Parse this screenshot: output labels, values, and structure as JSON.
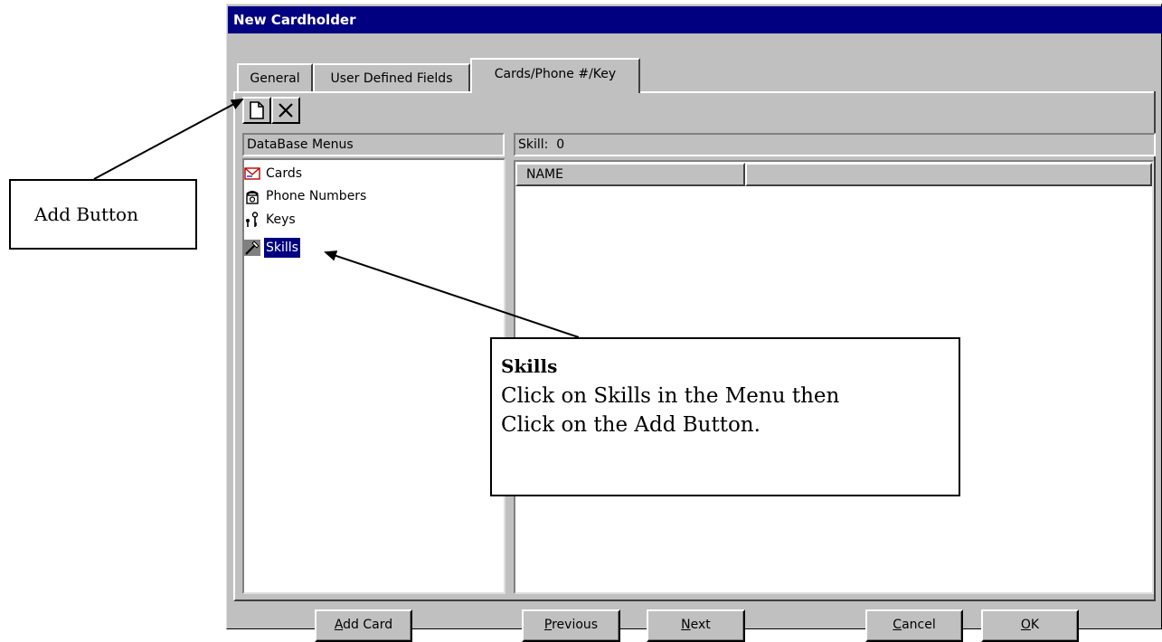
{
  "window": {
    "title": "New Cardholder"
  },
  "tabs": [
    {
      "label": "General",
      "active": false
    },
    {
      "label": "User Defined Fields",
      "active": false
    },
    {
      "label": "Cards/Phone #/Key",
      "active": true
    }
  ],
  "toolbar": {
    "add_icon": "new-document-icon",
    "delete_icon": "delete-x-icon"
  },
  "left_panel": {
    "header": "DataBase Menus",
    "items": [
      {
        "label": "Cards",
        "icon": "cards-icon",
        "selected": false
      },
      {
        "label": "Phone Numbers",
        "icon": "phone-icon",
        "selected": false
      },
      {
        "label": "Keys",
        "icon": "keys-icon",
        "selected": false
      },
      {
        "label": "Skills",
        "icon": "skills-icon",
        "selected": true
      }
    ]
  },
  "right_panel": {
    "header": "Skill:  0",
    "columns": [
      "NAME",
      ""
    ]
  },
  "buttons": {
    "add_card_prefix": "A",
    "add_card_rest": "dd Card",
    "previous_prefix": "P",
    "previous_rest": "revious",
    "next_prefix": "N",
    "next_rest": "ext",
    "cancel_prefix": "C",
    "cancel_rest": "ancel",
    "ok_prefix": "O",
    "ok_rest": "K"
  },
  "annotations": {
    "add_button_callout": "Add Button",
    "skills_callout_title": "Skills",
    "skills_callout_line1": "Click on Skills in the Menu then",
    "skills_callout_line2": "Click on the Add Button."
  }
}
